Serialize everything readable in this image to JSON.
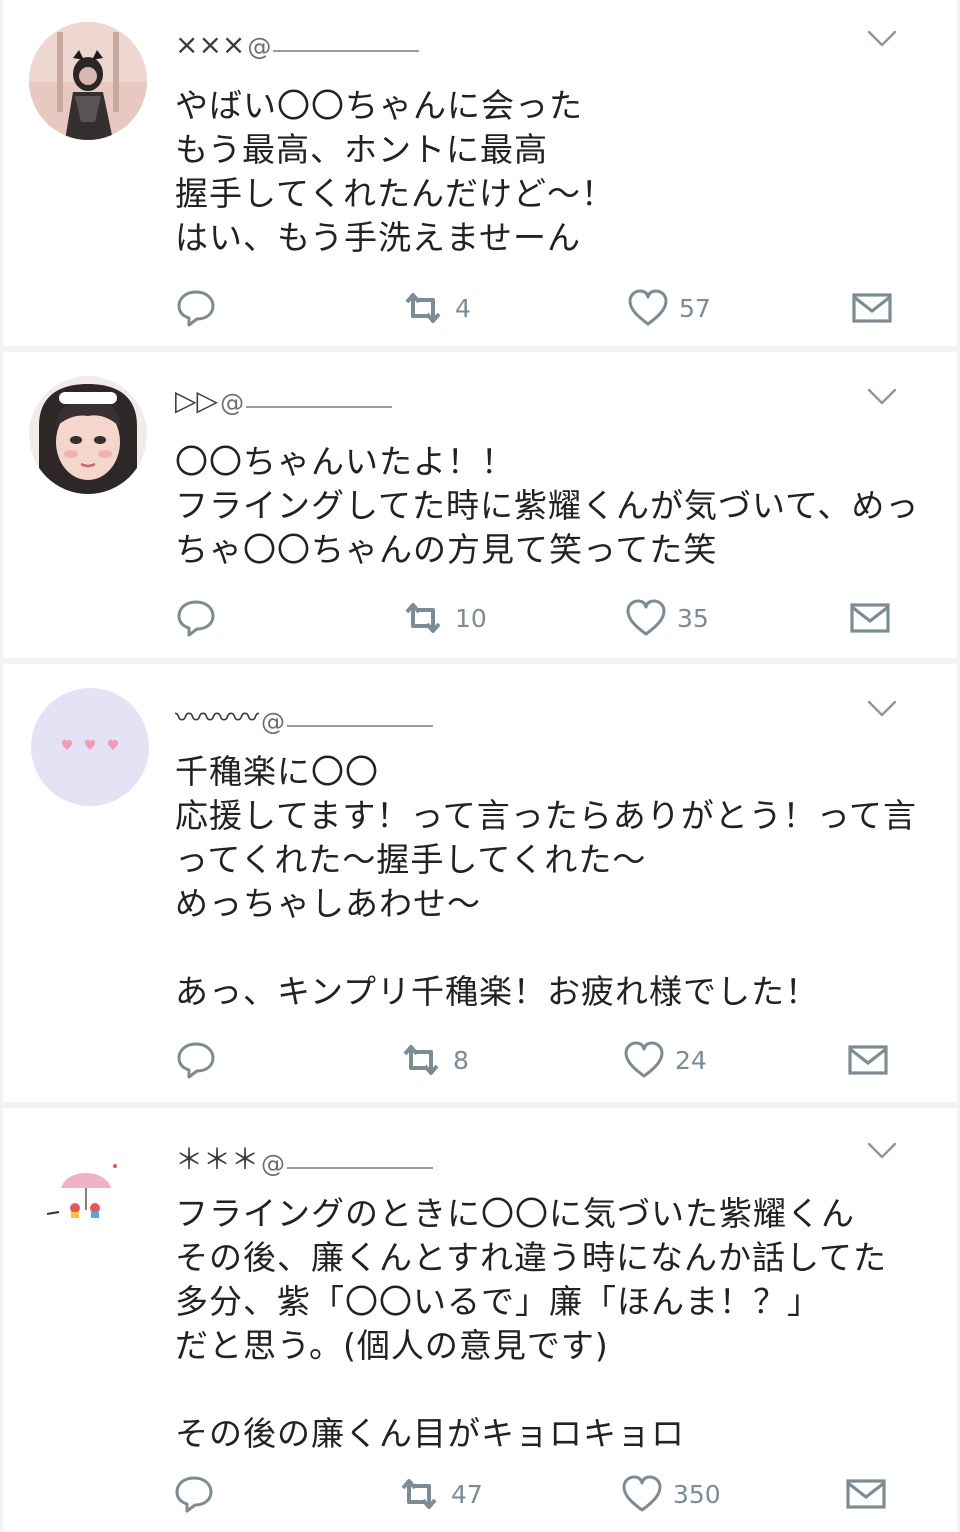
{
  "tweets": [
    {
      "handle": "×××",
      "text": "やばい〇〇ちゃんに会った\nもう最高、ホントに最高\n握手してくれたんだけど〜！\nはい、もう手洗えませーん",
      "retweets": "4",
      "likes": "57"
    },
    {
      "handle": "▷▷",
      "text": "〇〇ちゃんいたよ！！\nフライングしてた時に紫耀くんが気づいて、めっ\nちゃ〇〇ちゃんの方見て笑ってた笑",
      "retweets": "10",
      "likes": "35"
    },
    {
      "handle": "〰〰〰",
      "text": "千穐楽に〇〇\n応援してます！って言ったらありがとう！って言\nってくれた〜握手してくれた〜\nめっちゃしあわせ〜\n\nあっ、キンプリ千穐楽！お疲れ様でした！",
      "retweets": "8",
      "likes": "24"
    },
    {
      "handle": "＊＊＊",
      "text": "フライングのときに〇〇に気づいた紫耀くん\nその後、廉くんとすれ違う時になんか話してた\n多分、紫「〇〇いるで」廉「ほんま！？」\nだと思う。(個人の意見です)\n\nその後の廉くん目がキョロキョロ",
      "retweets": "47",
      "likes": "350"
    }
  ],
  "at_symbol": "@",
  "icons": {
    "reply": "reply-icon",
    "retweet": "retweet-icon",
    "like": "heart-icon",
    "dm": "envelope-icon",
    "menu": "chevron-down-icon"
  },
  "colors": {
    "icon": "#7d8b93",
    "text": "#222222",
    "divider": "#e3e8e8"
  }
}
